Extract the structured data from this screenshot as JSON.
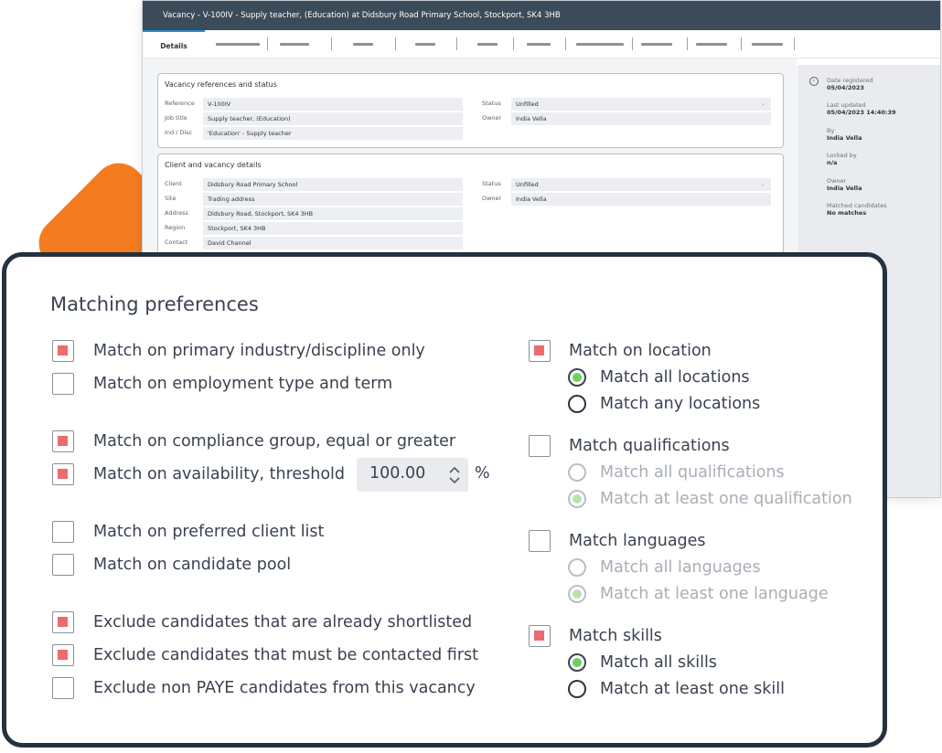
{
  "window": {
    "title": "Vacancy - V-100IV - Supply teacher, (Education) at Didsbury Road Primary School, Stockport, SK4 3HB",
    "active_tab": "Details"
  },
  "vacancy_refs": {
    "title": "Vacancy references and status",
    "fields": [
      {
        "label": "Reference",
        "value": "V-100IV"
      },
      {
        "label": "Job title",
        "value": "Supply teacher, (Education)"
      },
      {
        "label": "Ind / Disc",
        "value": "'Education' - Supply teacher"
      }
    ],
    "status_label": "Status",
    "status_value": "Unfilled",
    "owner_label": "Owner",
    "owner_value": "India Vella"
  },
  "client_details": {
    "title": "Client and vacancy details",
    "fields": [
      {
        "label": "Client",
        "value": "Didsbury Road Primary School"
      },
      {
        "label": "Site",
        "value": "Trading address"
      },
      {
        "label": "Address",
        "value": "Didsbury Road, Stockport, SK4 3HB"
      },
      {
        "label": "Region",
        "value": "Stockport, SK4 3HB"
      },
      {
        "label": "Contact",
        "value": "David Channel"
      }
    ],
    "status_label": "Status",
    "status_value": "Unfilled",
    "owner_label": "Owner",
    "owner_value": "India Vella"
  },
  "side_panel": {
    "items": [
      {
        "label": "Date registered",
        "value": "05/04/2023"
      },
      {
        "label": "Last updated",
        "value": "05/04/2023  14:40:39"
      },
      {
        "label": "By",
        "value": "India Vella"
      },
      {
        "label": "Locked by",
        "value": "n/a"
      },
      {
        "label": "Owner",
        "value": "India Vella"
      },
      {
        "label": "Matched candidates",
        "value": "No matches"
      }
    ]
  },
  "prefs": {
    "title": "Matching preferences",
    "left": [
      {
        "label": "Match on primary industry/discipline only",
        "checked": true
      },
      {
        "label": "Match on employment type and term",
        "checked": false
      },
      {
        "label": "Match on compliance group, equal or greater",
        "checked": true
      },
      {
        "label": "Match on availability, threshold",
        "checked": true
      },
      {
        "label": "Match on preferred client list",
        "checked": false
      },
      {
        "label": "Match on candidate pool",
        "checked": false
      },
      {
        "label": "Exclude candidates that are already shortlisted",
        "checked": true
      },
      {
        "label": "Exclude candidates that must be contacted first",
        "checked": true
      },
      {
        "label": "Exclude non PAYE candidates from this vacancy",
        "checked": false
      }
    ],
    "threshold_value": "100.00",
    "threshold_unit": "%",
    "location": {
      "label": "Match on location",
      "checked": true,
      "options": [
        "Match all locations",
        "Match any locations"
      ],
      "selected": 0
    },
    "qualifications": {
      "label": "Match qualifications",
      "checked": false,
      "options": [
        "Match all qualifications",
        "Match at least one qualification"
      ],
      "selected": 1
    },
    "languages": {
      "label": "Match languages",
      "checked": false,
      "options": [
        "Match all languages",
        "Match at least one language"
      ],
      "selected": 1
    },
    "skills": {
      "label": "Match skills",
      "checked": true,
      "options": [
        "Match all skills",
        "Match at least one skill"
      ],
      "selected": 0
    }
  },
  "colors": {
    "accent_checked": "#ec6b6f",
    "radio_selected": "#6fcf5a",
    "card_border": "#243240",
    "titlebar": "#3c4b5a",
    "decor": "#f47b20"
  }
}
